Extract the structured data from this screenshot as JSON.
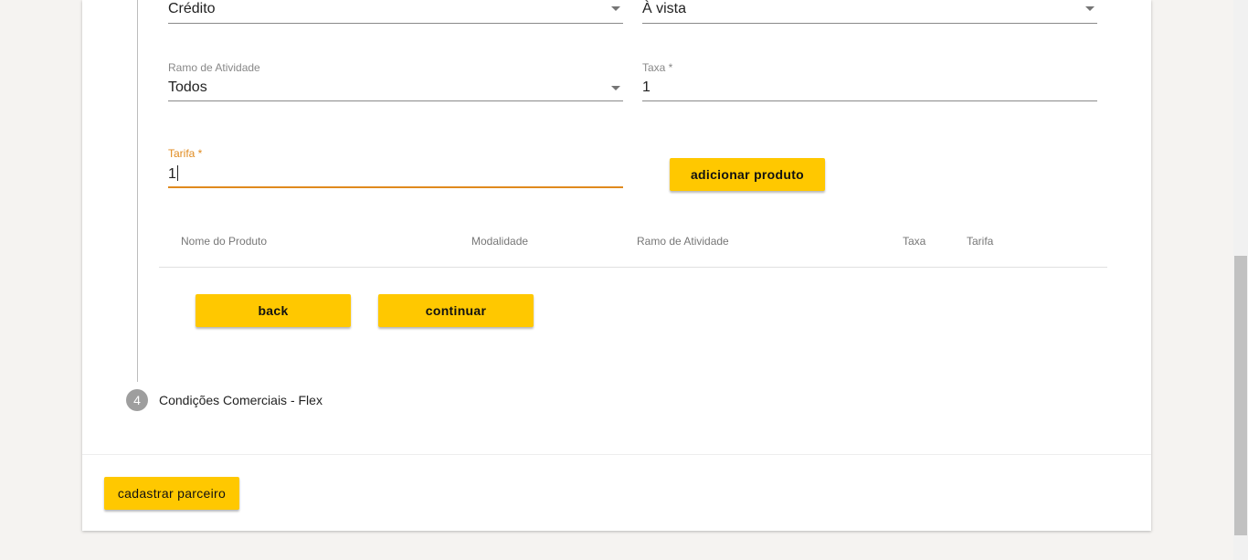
{
  "form": {
    "row1": {
      "left": {
        "value": "Crédito"
      },
      "right": {
        "value": "À vista"
      }
    },
    "ramo": {
      "label": "Ramo de Atividade",
      "value": "Todos"
    },
    "taxa": {
      "label": "Taxa *",
      "value": "1"
    },
    "tarifa": {
      "label": "Tarifa *",
      "value": "1"
    },
    "add_button": "adicionar produto"
  },
  "table": {
    "columns": [
      "Nome do Produto",
      "Modalidade",
      "Ramo de Atividade",
      "Taxa",
      "Tarifa"
    ]
  },
  "actions": {
    "back": "back",
    "continue": "continuar"
  },
  "step4": {
    "number": "4",
    "label": "Condições Comerciais - Flex"
  },
  "footer": {
    "submit": "cadastrar parceiro"
  },
  "colors": {
    "accent_button": "#ffc800",
    "focus_underline": "#e08a1e",
    "step_circle": "#9e9e9e"
  },
  "icons": {
    "dropdown": "caret-down-icon"
  }
}
